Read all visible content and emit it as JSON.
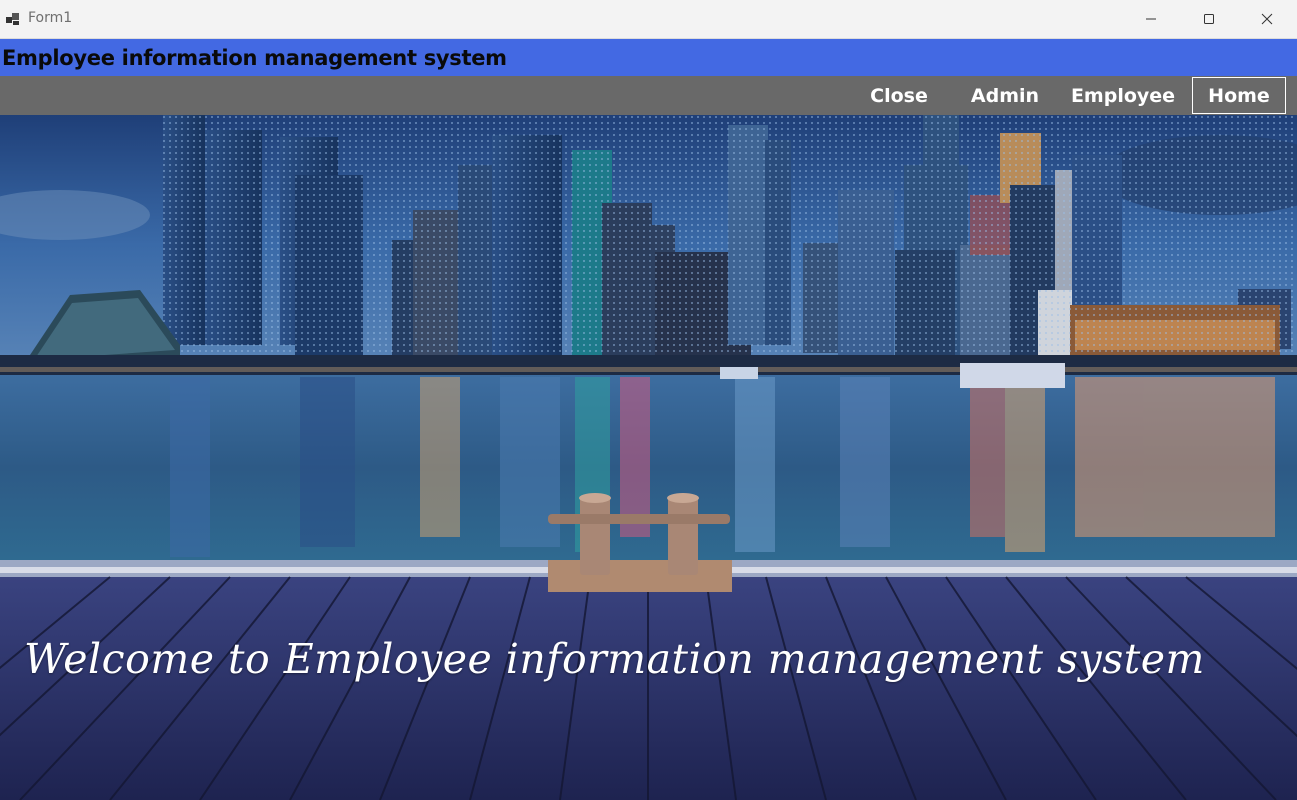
{
  "window": {
    "title": "Form1",
    "controls": {
      "minimize_icon": "minimize-icon",
      "maximize_icon": "maximize-icon",
      "close_icon": "close-icon"
    }
  },
  "header": {
    "title": "Employee information management system",
    "color": "#4369e3"
  },
  "nav": {
    "background": "#696969",
    "items": [
      {
        "label": "Close"
      },
      {
        "label": "Admin"
      },
      {
        "label": "Employee"
      },
      {
        "label": "Home",
        "selected": true
      }
    ]
  },
  "hero": {
    "welcome_text": "Welcome to Employee information management system"
  }
}
